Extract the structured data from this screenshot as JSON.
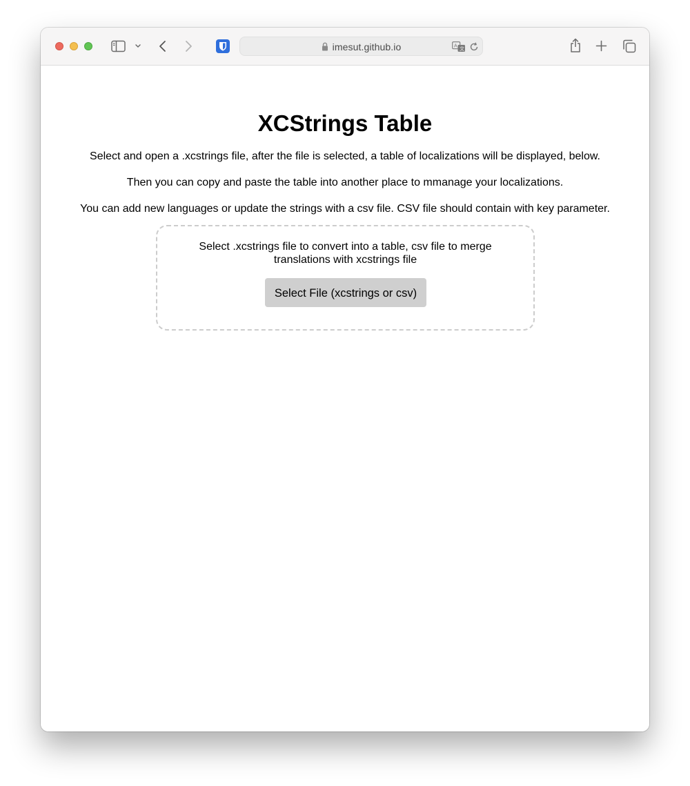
{
  "browser": {
    "url": "imesut.github.io",
    "colors": {
      "toolbar_bg": "#f6f5f5",
      "close": "#ed6a5e",
      "minimize": "#f4bf4f",
      "zoom": "#61c554",
      "extension": "#2f6fdc"
    },
    "icons": [
      "sidebar-icon",
      "chevron-down-icon",
      "back-arrow-icon",
      "forward-arrow-icon",
      "bitwarden-extension-icon",
      "lock-icon",
      "translate-icon",
      "reload-icon",
      "share-icon",
      "new-tab-plus-icon",
      "tabs-overview-icon"
    ]
  },
  "page": {
    "title": "XCStrings Table",
    "paragraphs": [
      "Select and open a .xcstrings file, after the file is selected, a table of localizations will be displayed, below.",
      "Then you can copy and paste the table into another place to mmanage your localizations.",
      "You can add new languages or update the strings with a csv file. CSV file should contain with key parameter."
    ],
    "dropzone": {
      "hint": "Select .xcstrings file to convert into a table, csv file to merge translations with xcstrings file",
      "button_label": "Select File (xcstrings or csv)"
    }
  }
}
